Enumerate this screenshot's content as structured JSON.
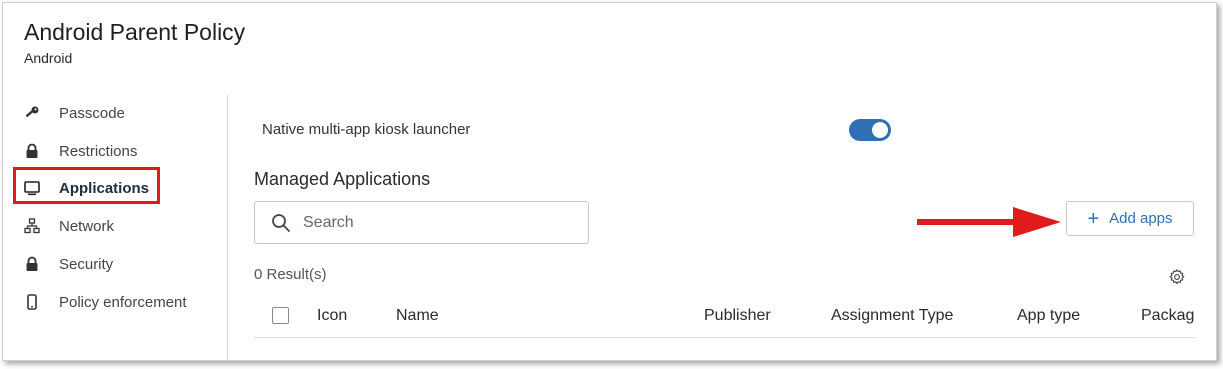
{
  "header": {
    "title": "Android Parent Policy",
    "subtitle": "Android"
  },
  "sidebar": {
    "items": [
      {
        "label": "Passcode",
        "icon": "key-icon"
      },
      {
        "label": "Restrictions",
        "icon": "lock-icon"
      },
      {
        "label": "Applications",
        "icon": "monitor-icon",
        "active": true
      },
      {
        "label": "Network",
        "icon": "network-icon"
      },
      {
        "label": "Security",
        "icon": "lock-icon"
      },
      {
        "label": "Policy enforcement",
        "icon": "phone-icon"
      }
    ]
  },
  "main": {
    "kiosk": {
      "label": "Native multi-app kiosk launcher",
      "enabled": true
    },
    "section_title": "Managed Applications",
    "search": {
      "placeholder": "Search",
      "value": ""
    },
    "add_button": {
      "label": "Add apps",
      "icon": "plus-icon"
    },
    "results": "0 Result(s)",
    "table": {
      "columns": [
        "Icon",
        "Name",
        "Publisher",
        "Assignment Type",
        "App type",
        "Packag"
      ]
    }
  },
  "colors": {
    "accent": "#2f6fb3",
    "annotation": "#e01b1b"
  }
}
